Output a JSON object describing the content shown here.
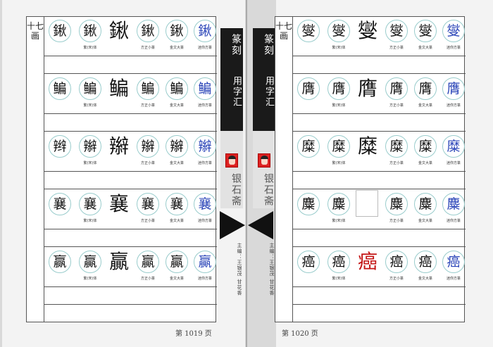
{
  "colors": {
    "seal_red": "#c41616",
    "blue_script": "#2b45b8",
    "spine_dark": "#1a1a1a"
  },
  "captions": {
    "traditional": "繁(宋)体",
    "fangzheng": "方正小篆",
    "jinwen": "金文大篆",
    "dini": "迷你方篆"
  },
  "left_page": {
    "radical": "十七画",
    "rows": [
      {
        "main": "鍬",
        "trad": "鍬",
        "large": "鍬",
        "fz": "鍬",
        "jw": "鍬",
        "dn": "鍬"
      },
      {
        "main": "鳊",
        "trad": "鳊",
        "large": "鳊",
        "fz": "鳊",
        "jw": "鳊",
        "dn": "鳊"
      },
      {
        "main": "辫",
        "trad": "辮",
        "large": "辮",
        "fz": "辮",
        "jw": "辮",
        "dn": "辮"
      },
      {
        "main": "襄",
        "trad": "襄",
        "large": "襄",
        "fz": "襄",
        "jw": "襄",
        "dn": "襄"
      },
      {
        "main": "赢",
        "trad": "贏",
        "large": "贏",
        "fz": "贏",
        "jw": "贏",
        "dn": "贏"
      }
    ],
    "page_number": "第 1019 页"
  },
  "right_page": {
    "radical": "十七画",
    "rows": [
      {
        "main": "燮",
        "trad": "燮",
        "large": "燮",
        "fz": "燮",
        "jw": "燮",
        "dn": "燮"
      },
      {
        "main": "膺",
        "trad": "膺",
        "large": "膺",
        "fz": "膺",
        "jw": "膺",
        "dn": "膺"
      },
      {
        "main": "糜",
        "trad": "糜",
        "large": "糜",
        "fz": "糜",
        "jw": "糜",
        "dn": "糜"
      },
      {
        "main": "麋",
        "trad": "麋",
        "large": "",
        "fz": "麋",
        "jw": "麋",
        "dn": "麋"
      },
      {
        "main": "癌",
        "trad": "癌",
        "large": "癌",
        "fz": "癌",
        "jw": "癌",
        "dn": "癌"
      }
    ],
    "page_number": "第 1020 页"
  },
  "spine": {
    "title_script": "篆刻",
    "title_text": "用字汇",
    "publisher": "银石斋",
    "editors": "主编：王银茂 甘花香"
  }
}
